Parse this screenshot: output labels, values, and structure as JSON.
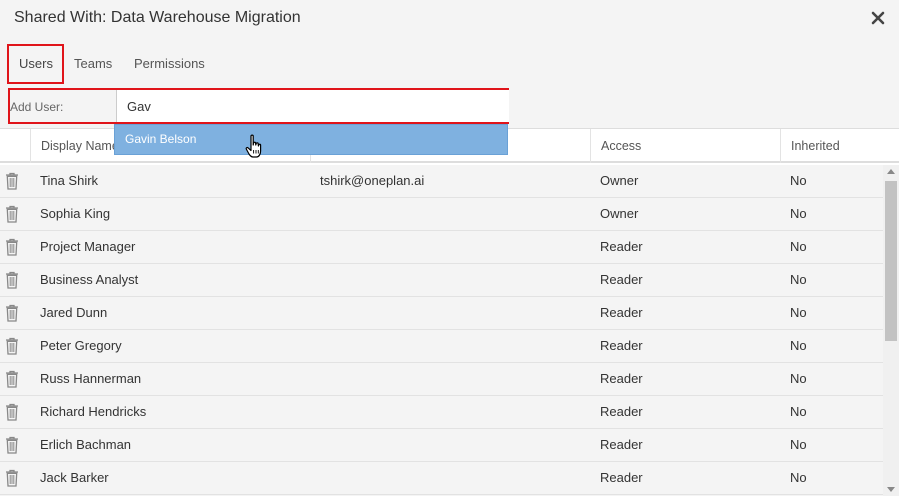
{
  "dialog": {
    "title": "Shared With: Data Warehouse Migration",
    "close_icon": "close-icon"
  },
  "tabs": [
    {
      "label": "Users",
      "active": true
    },
    {
      "label": "Teams",
      "active": false
    },
    {
      "label": "Permissions",
      "active": false
    }
  ],
  "add_user": {
    "label": "Add User:",
    "value": "Gav",
    "suggestion": "Gavin Belson"
  },
  "table": {
    "columns": [
      "Display Name",
      "",
      "Access",
      "Inherited"
    ],
    "rows": [
      {
        "name": "Tina Shirk",
        "email": "tshirk@oneplan.ai",
        "access": "Owner",
        "inherited": "No"
      },
      {
        "name": "Sophia King",
        "email": "",
        "access": "Owner",
        "inherited": "No"
      },
      {
        "name": "Project Manager",
        "email": "",
        "access": "Reader",
        "inherited": "No"
      },
      {
        "name": "Business Analyst",
        "email": "",
        "access": "Reader",
        "inherited": "No"
      },
      {
        "name": "Jared Dunn",
        "email": "",
        "access": "Reader",
        "inherited": "No"
      },
      {
        "name": "Peter Gregory",
        "email": "",
        "access": "Reader",
        "inherited": "No"
      },
      {
        "name": "Russ Hannerman",
        "email": "",
        "access": "Reader",
        "inherited": "No"
      },
      {
        "name": "Richard Hendricks",
        "email": "",
        "access": "Reader",
        "inherited": "No"
      },
      {
        "name": "Erlich Bachman",
        "email": "",
        "access": "Reader",
        "inherited": "No"
      },
      {
        "name": "Jack Barker",
        "email": "",
        "access": "Reader",
        "inherited": "No"
      }
    ]
  },
  "colors": {
    "highlight_border": "#e0141a",
    "suggestion_bg": "#7fb1e0"
  }
}
